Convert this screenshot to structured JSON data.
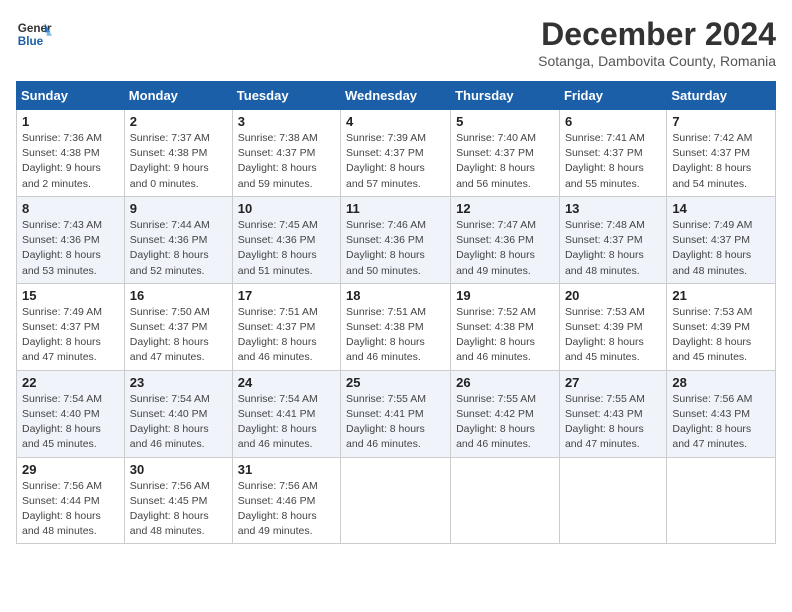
{
  "logo": {
    "line1": "General",
    "line2": "Blue"
  },
  "title": "December 2024",
  "subtitle": "Sotanga, Dambovita County, Romania",
  "days_of_week": [
    "Sunday",
    "Monday",
    "Tuesday",
    "Wednesday",
    "Thursday",
    "Friday",
    "Saturday"
  ],
  "weeks": [
    [
      {
        "day": "1",
        "info": "Sunrise: 7:36 AM\nSunset: 4:38 PM\nDaylight: 9 hours\nand 2 minutes."
      },
      {
        "day": "2",
        "info": "Sunrise: 7:37 AM\nSunset: 4:38 PM\nDaylight: 9 hours\nand 0 minutes."
      },
      {
        "day": "3",
        "info": "Sunrise: 7:38 AM\nSunset: 4:37 PM\nDaylight: 8 hours\nand 59 minutes."
      },
      {
        "day": "4",
        "info": "Sunrise: 7:39 AM\nSunset: 4:37 PM\nDaylight: 8 hours\nand 57 minutes."
      },
      {
        "day": "5",
        "info": "Sunrise: 7:40 AM\nSunset: 4:37 PM\nDaylight: 8 hours\nand 56 minutes."
      },
      {
        "day": "6",
        "info": "Sunrise: 7:41 AM\nSunset: 4:37 PM\nDaylight: 8 hours\nand 55 minutes."
      },
      {
        "day": "7",
        "info": "Sunrise: 7:42 AM\nSunset: 4:37 PM\nDaylight: 8 hours\nand 54 minutes."
      }
    ],
    [
      {
        "day": "8",
        "info": "Sunrise: 7:43 AM\nSunset: 4:36 PM\nDaylight: 8 hours\nand 53 minutes."
      },
      {
        "day": "9",
        "info": "Sunrise: 7:44 AM\nSunset: 4:36 PM\nDaylight: 8 hours\nand 52 minutes."
      },
      {
        "day": "10",
        "info": "Sunrise: 7:45 AM\nSunset: 4:36 PM\nDaylight: 8 hours\nand 51 minutes."
      },
      {
        "day": "11",
        "info": "Sunrise: 7:46 AM\nSunset: 4:36 PM\nDaylight: 8 hours\nand 50 minutes."
      },
      {
        "day": "12",
        "info": "Sunrise: 7:47 AM\nSunset: 4:36 PM\nDaylight: 8 hours\nand 49 minutes."
      },
      {
        "day": "13",
        "info": "Sunrise: 7:48 AM\nSunset: 4:37 PM\nDaylight: 8 hours\nand 48 minutes."
      },
      {
        "day": "14",
        "info": "Sunrise: 7:49 AM\nSunset: 4:37 PM\nDaylight: 8 hours\nand 48 minutes."
      }
    ],
    [
      {
        "day": "15",
        "info": "Sunrise: 7:49 AM\nSunset: 4:37 PM\nDaylight: 8 hours\nand 47 minutes."
      },
      {
        "day": "16",
        "info": "Sunrise: 7:50 AM\nSunset: 4:37 PM\nDaylight: 8 hours\nand 47 minutes."
      },
      {
        "day": "17",
        "info": "Sunrise: 7:51 AM\nSunset: 4:37 PM\nDaylight: 8 hours\nand 46 minutes."
      },
      {
        "day": "18",
        "info": "Sunrise: 7:51 AM\nSunset: 4:38 PM\nDaylight: 8 hours\nand 46 minutes."
      },
      {
        "day": "19",
        "info": "Sunrise: 7:52 AM\nSunset: 4:38 PM\nDaylight: 8 hours\nand 46 minutes."
      },
      {
        "day": "20",
        "info": "Sunrise: 7:53 AM\nSunset: 4:39 PM\nDaylight: 8 hours\nand 45 minutes."
      },
      {
        "day": "21",
        "info": "Sunrise: 7:53 AM\nSunset: 4:39 PM\nDaylight: 8 hours\nand 45 minutes."
      }
    ],
    [
      {
        "day": "22",
        "info": "Sunrise: 7:54 AM\nSunset: 4:40 PM\nDaylight: 8 hours\nand 45 minutes."
      },
      {
        "day": "23",
        "info": "Sunrise: 7:54 AM\nSunset: 4:40 PM\nDaylight: 8 hours\nand 46 minutes."
      },
      {
        "day": "24",
        "info": "Sunrise: 7:54 AM\nSunset: 4:41 PM\nDaylight: 8 hours\nand 46 minutes."
      },
      {
        "day": "25",
        "info": "Sunrise: 7:55 AM\nSunset: 4:41 PM\nDaylight: 8 hours\nand 46 minutes."
      },
      {
        "day": "26",
        "info": "Sunrise: 7:55 AM\nSunset: 4:42 PM\nDaylight: 8 hours\nand 46 minutes."
      },
      {
        "day": "27",
        "info": "Sunrise: 7:55 AM\nSunset: 4:43 PM\nDaylight: 8 hours\nand 47 minutes."
      },
      {
        "day": "28",
        "info": "Sunrise: 7:56 AM\nSunset: 4:43 PM\nDaylight: 8 hours\nand 47 minutes."
      }
    ],
    [
      {
        "day": "29",
        "info": "Sunrise: 7:56 AM\nSunset: 4:44 PM\nDaylight: 8 hours\nand 48 minutes."
      },
      {
        "day": "30",
        "info": "Sunrise: 7:56 AM\nSunset: 4:45 PM\nDaylight: 8 hours\nand 48 minutes."
      },
      {
        "day": "31",
        "info": "Sunrise: 7:56 AM\nSunset: 4:46 PM\nDaylight: 8 hours\nand 49 minutes."
      },
      {
        "day": "",
        "info": ""
      },
      {
        "day": "",
        "info": ""
      },
      {
        "day": "",
        "info": ""
      },
      {
        "day": "",
        "info": ""
      }
    ]
  ]
}
